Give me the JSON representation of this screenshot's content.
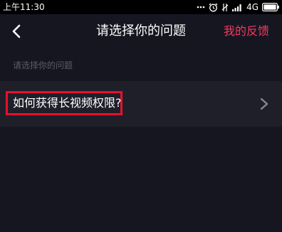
{
  "status_bar": {
    "time": "上午11:30",
    "network": "4G"
  },
  "nav": {
    "title": "请选择你的问题",
    "feedback_label": "我的反馈"
  },
  "section": {
    "label": "请选择你的问题"
  },
  "questions": [
    {
      "label": "如何获得长视频权限?"
    }
  ],
  "colors": {
    "background": "#161621",
    "row_background": "#1f1f2a",
    "accent": "#f5395e",
    "highlight_border": "#e8102a",
    "muted_text": "#5c5c68"
  },
  "icons": {
    "back": "chevron-left-icon",
    "row_arrow": "chevron-right-icon",
    "status": [
      "more-dots-icon",
      "alarm-icon",
      "mute-icon",
      "signal-icon",
      "battery-icon"
    ]
  }
}
